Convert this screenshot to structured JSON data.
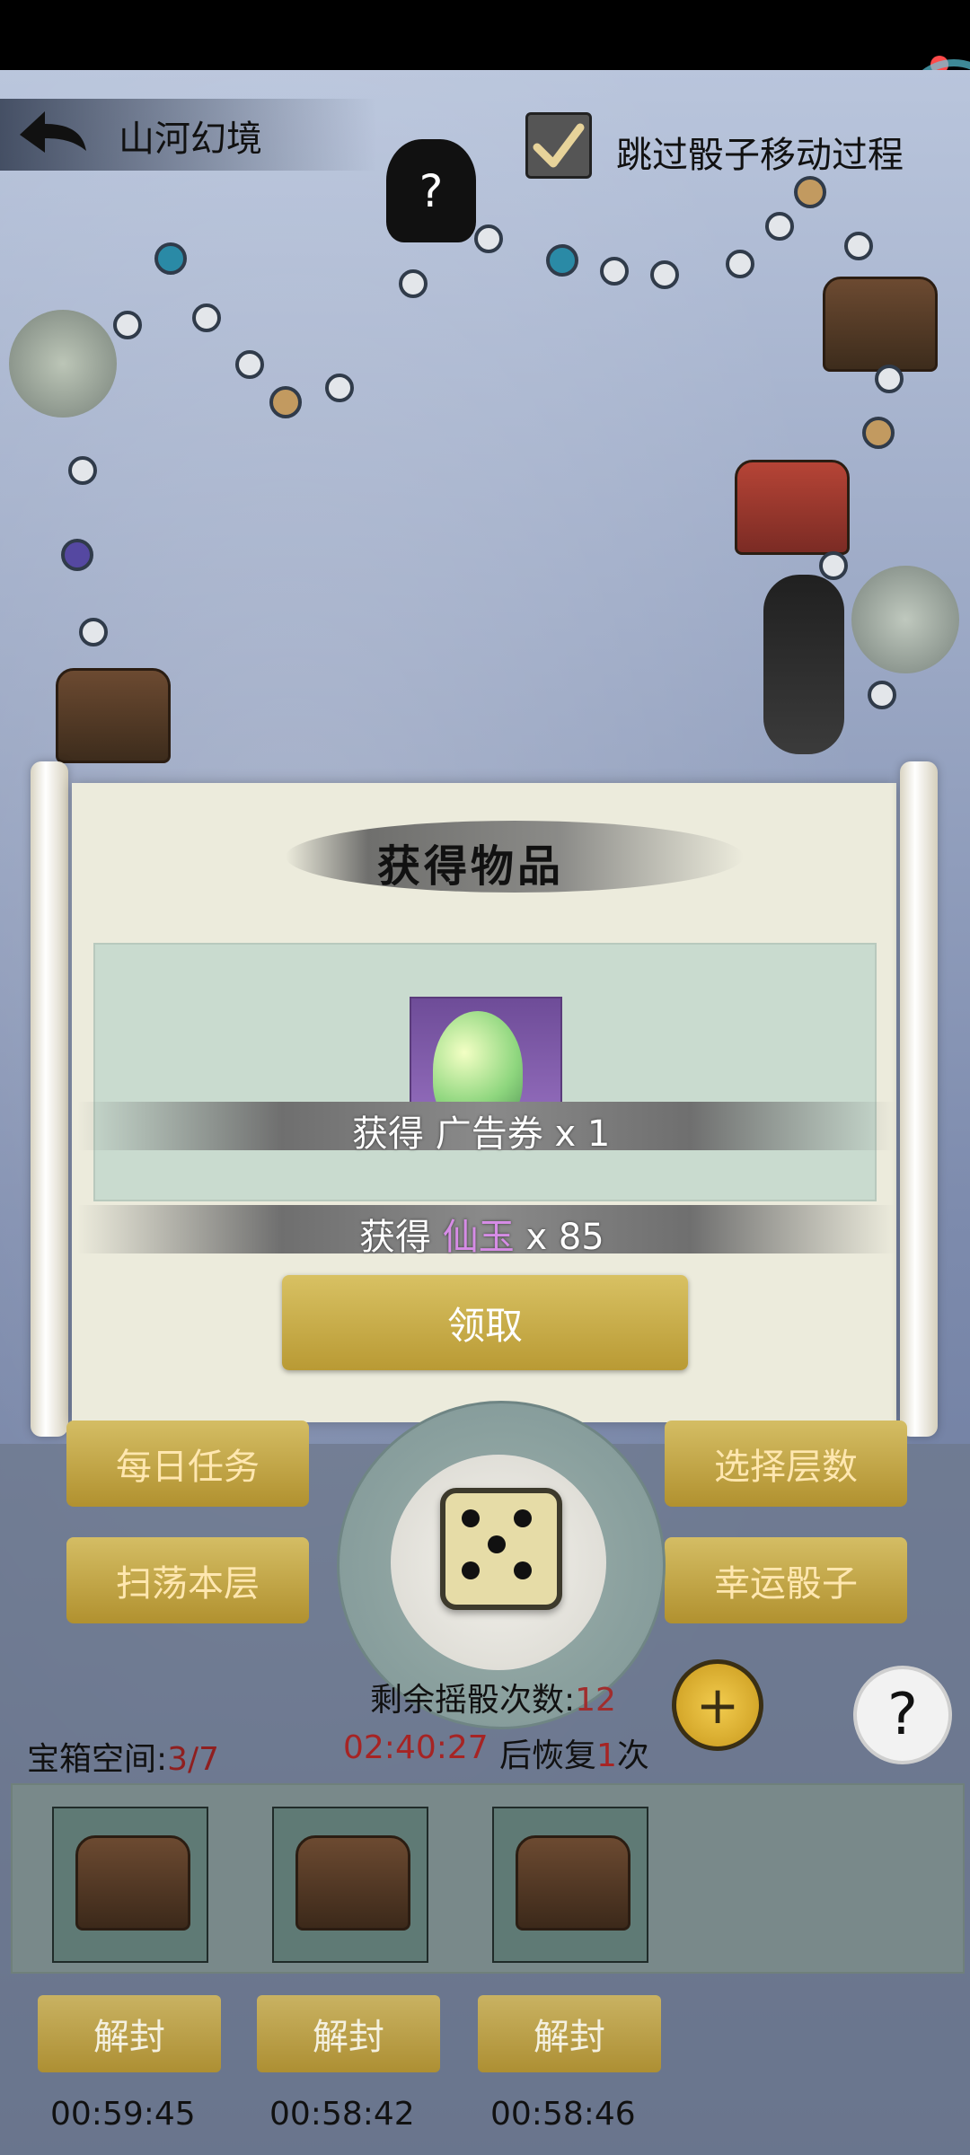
{
  "header": {
    "title": "山河幻境",
    "skip_dice_animation": "跳过骰子移动过程"
  },
  "modal": {
    "title": "获得物品",
    "reward_ad_prefix": "获得 ",
    "reward_ad_item": "广告券",
    "reward_ad_qty": "x 1",
    "reward_jade_prefix": "获得 ",
    "reward_jade_item": "仙玉",
    "reward_jade_qty": "x 85",
    "claim_button": "领取"
  },
  "controls": {
    "daily_tasks": "每日任务",
    "select_floor": "选择层数",
    "sweep_floor": "扫荡本层",
    "lucky_dice": "幸运骰子"
  },
  "dice": {
    "remaining_label": "剩余摇骰次数:",
    "remaining_count": "12",
    "recover_timer": "02:40:27",
    "recover_prefix": "后恢复",
    "recover_count": "1",
    "recover_suffix": "次"
  },
  "treasure": {
    "space_label": "宝箱空间:",
    "space_value": "3/7",
    "unseal_label": "解封",
    "timers": [
      "00:59:45",
      "00:58:42",
      "00:58:46"
    ]
  },
  "colors": {
    "gold_button": "#d4bd64",
    "accent_red": "#a62424",
    "accent_purple": "#d68ce6"
  }
}
